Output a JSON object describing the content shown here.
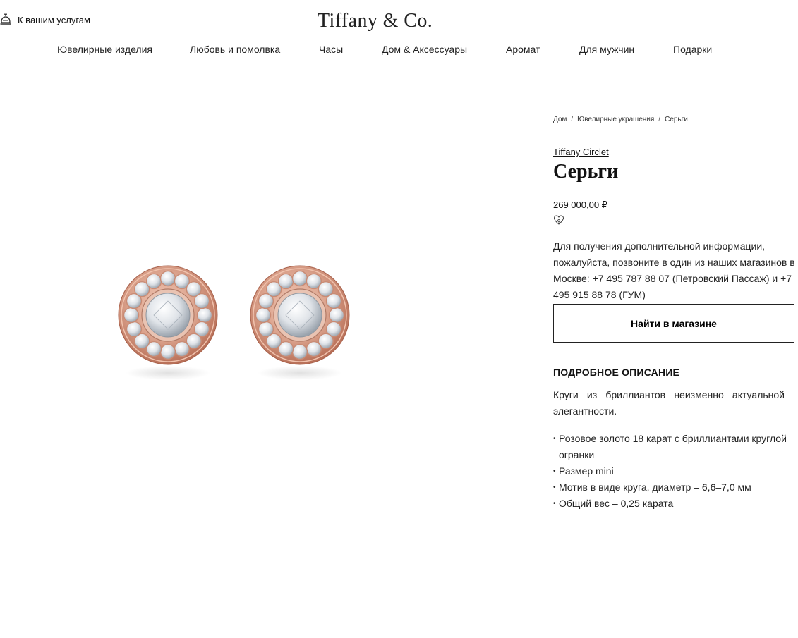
{
  "header": {
    "concierge_label": "К вашим услугам",
    "logo_text": "Tiffany & Co.",
    "icons": {
      "concierge": "service-bell-icon",
      "wishlist": "heart-outline-icon"
    }
  },
  "nav": {
    "items": [
      "Ювелирные изделия",
      "Любовь и помолвка",
      "Часы",
      "Дом & Аксессуары",
      "Аромат",
      "Для мужчин",
      "Подарки"
    ]
  },
  "breadcrumb": {
    "items": [
      "Дом",
      "Ювелирные украшения",
      "Серьги"
    ],
    "separator": "/"
  },
  "product": {
    "collection": "Tiffany Circlet",
    "title": "Серьги",
    "price": "269 000,00 ₽",
    "info": "Для получения дополнительной информации, пожалуйста, позвоните в один из наших магазинов в Москве: +7 495 787 88 07 (Петровский Пассаж) и +7 495 915 88 78 (ГУМ)",
    "find_button": "Найти в магазине",
    "details_heading": "ПОДРОБНОЕ ОПИСАНИЕ",
    "description": "Круги из бриллиантов неизменно актуальной элегантности.",
    "features": [
      "Розовое золото 18 карат с бриллиантами круглой огранки",
      "Размер mini",
      "Мотив в виде круга, диаметр – 6,6–7,0 мм",
      "Общий вес – 0,25 карата"
    ]
  },
  "colors": {
    "rose_gold": "#d9a08a",
    "rose_gold_dark": "#b86f57",
    "text": "#222222"
  }
}
